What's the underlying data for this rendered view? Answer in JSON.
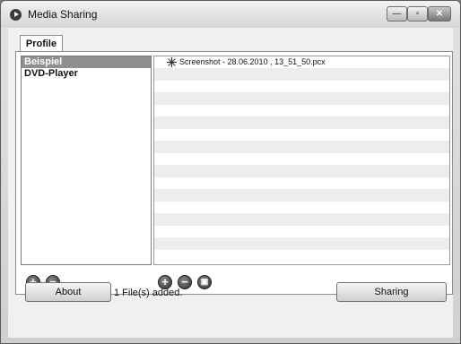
{
  "window": {
    "title": "Media Sharing"
  },
  "window_controls": {
    "minimize": "—",
    "maximize": "▫",
    "close": "✕"
  },
  "tabs": [
    {
      "label": "Profile"
    }
  ],
  "profiles": [
    {
      "label": "Beispiel",
      "selected": true
    },
    {
      "label": "DVD-Player",
      "selected": false
    }
  ],
  "files": [
    {
      "label": "Screenshot - 28.06.2010 , 13_51_50.pcx"
    }
  ],
  "buttons": {
    "add_profile": "+",
    "remove_profile": "−",
    "add_file": "+",
    "remove_file": "−",
    "add_folder": "▣",
    "about": "About",
    "sharing": "Sharing"
  },
  "status": {
    "text": "1 File(s) added."
  },
  "icons": {
    "app": "play-circle-icon",
    "file": "file-icon"
  }
}
